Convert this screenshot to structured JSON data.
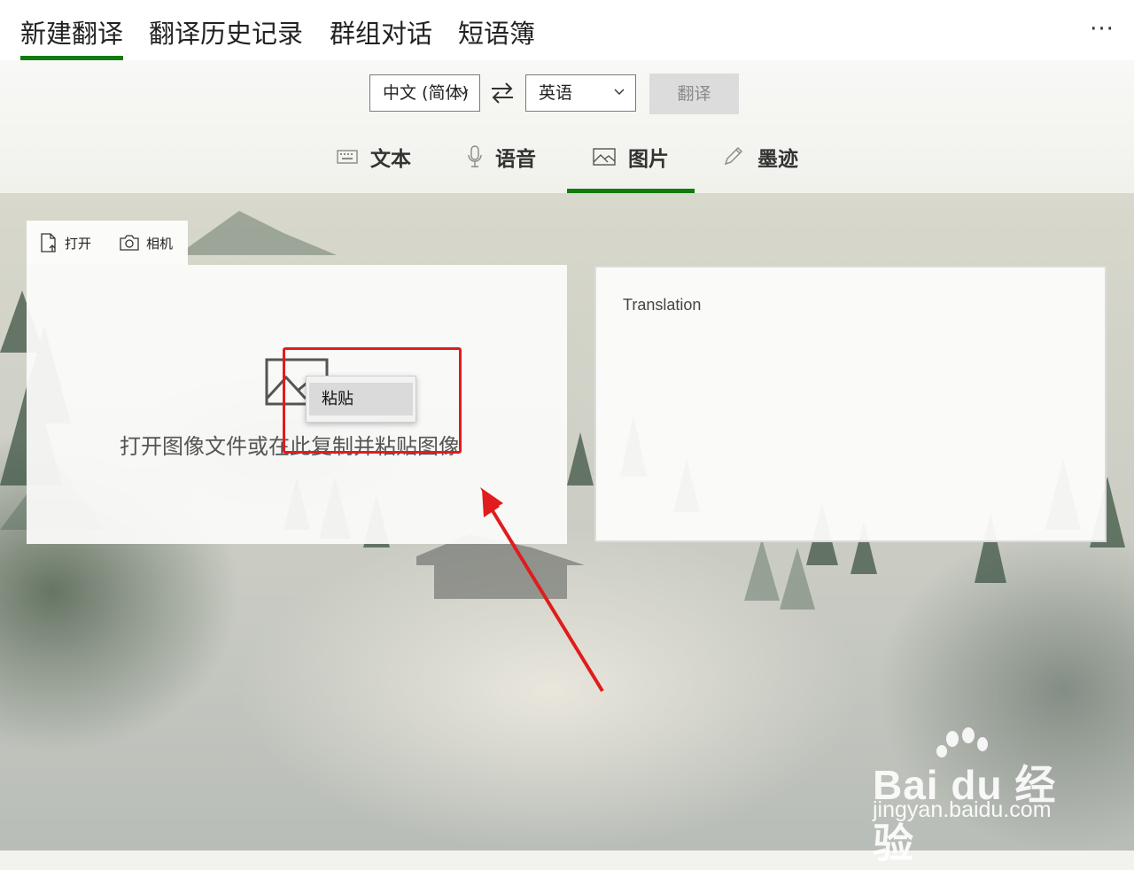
{
  "top_tabs": [
    {
      "label": "新建翻译",
      "active": true
    },
    {
      "label": "翻译历史记录",
      "active": false
    },
    {
      "label": "群组对话",
      "active": false
    },
    {
      "label": "短语簿",
      "active": false
    }
  ],
  "more_label": "···",
  "language_bar": {
    "source_language": "中文 (简体)",
    "target_language": "英语",
    "translate_label": "翻译"
  },
  "mode_tabs": [
    {
      "label": "文本",
      "icon": "keyboard-icon",
      "active": false
    },
    {
      "label": "语音",
      "icon": "microphone-icon",
      "active": false
    },
    {
      "label": "图片",
      "icon": "image-icon",
      "active": true
    },
    {
      "label": "墨迹",
      "icon": "pen-icon",
      "active": false
    }
  ],
  "image_toolbar": {
    "open_label": "打开",
    "camera_label": "相机"
  },
  "input_panel": {
    "hint": "打开图像文件或在此复制并粘贴图像"
  },
  "context_menu": {
    "items": [
      {
        "label": "粘贴"
      }
    ]
  },
  "output_panel": {
    "label": "Translation"
  },
  "watermark": {
    "brand": "Bai du 经验",
    "site": "jingyan.baidu.com"
  },
  "colors": {
    "accent": "#107c10",
    "annotation": "#e01c1c"
  }
}
